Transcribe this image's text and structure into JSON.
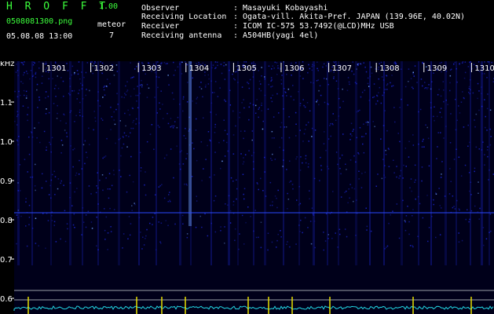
{
  "header": {
    "app_title": "H R O F F T",
    "app_version": "1.00",
    "file_name": "0508081300.png",
    "meteor_label": "meteor",
    "meteor_count": "7",
    "datetime": "05.08.08 13:00"
  },
  "info": [
    {
      "key": "Observer",
      "value": ": Masayuki Kobayashi"
    },
    {
      "key": "Receiving Location",
      "value": ": Ogata-vill. Akita-Pref. JAPAN (139.96E, 40.02N)"
    },
    {
      "key": "Receiver",
      "value": ": ICOM IC-575 53.7492(@LCD)MHz USB"
    },
    {
      "key": "Receiving antenna",
      "value": ": A504HB(yagi 4el)"
    }
  ],
  "spectrogram": {
    "y_unit": "kHz",
    "y_ticks": [
      "1.1",
      "1.0",
      "0.9",
      "0.8",
      "0.7",
      "0.6"
    ],
    "time_ticks": [
      "1301",
      "1302",
      "1303",
      "1304",
      "1305",
      "1306",
      "1307",
      "1308",
      "1309",
      "1310"
    ],
    "colors": {
      "background": "#00001a",
      "noise": "#1a24c8",
      "highlight": "#6fa0ff",
      "axis": "#ffffff",
      "trace": "#22d8e6",
      "tick_marker": "#e8e000"
    }
  }
}
